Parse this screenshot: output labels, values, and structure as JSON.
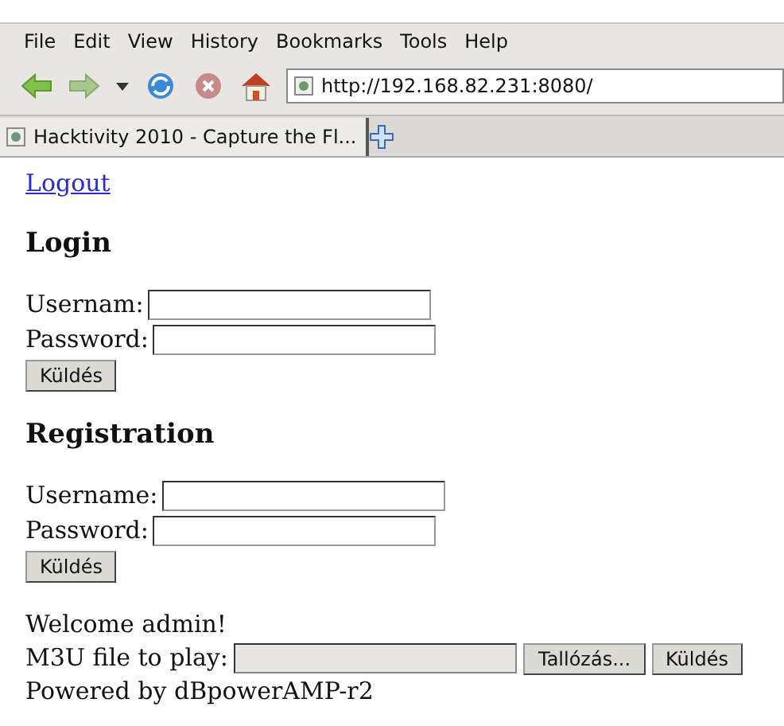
{
  "menu": [
    "File",
    "Edit",
    "View",
    "History",
    "Bookmarks",
    "Tools",
    "Help"
  ],
  "address": "http://192.168.82.231:8080/",
  "tabs": [
    {
      "label": "Hacktivity 2010 - Capture the Fl...",
      "selected": true
    }
  ],
  "page": {
    "logout": "Logout",
    "forms": [
      {
        "title": "Login",
        "fields": [
          {
            "label": "Usernam:"
          },
          {
            "label": "Password:"
          }
        ],
        "button": "Küldés"
      },
      {
        "title": "Registration",
        "fields": [
          {
            "label": "Username:"
          },
          {
            "label": "Password:"
          }
        ],
        "button": "Küldés"
      }
    ],
    "welcome": "Welcome admin!",
    "file_label": "M3U file to play:",
    "browse_button": "Tallózás...",
    "submit_button": "Küldés",
    "footer": "Powered by dBpowerAMP-r2"
  }
}
